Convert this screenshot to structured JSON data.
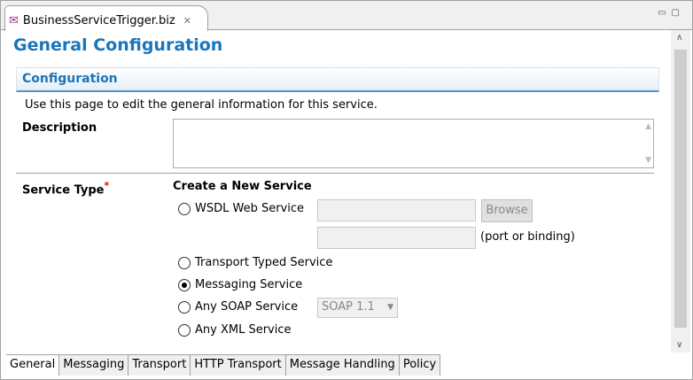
{
  "editor_tab": {
    "title": "BusinessServiceTrigger.biz",
    "icon": "biz-file-icon"
  },
  "page_title": "General Configuration",
  "section": {
    "title": "Configuration",
    "intro": "Use this page to edit the general information for this service."
  },
  "description": {
    "label": "Description",
    "value": ""
  },
  "service_type": {
    "label": "Service Type",
    "required_mark": "*",
    "heading": "Create a New Service",
    "options": [
      {
        "label": "WSDL Web Service",
        "selected": false
      },
      {
        "label": "Transport Typed Service",
        "selected": false
      },
      {
        "label": "Messaging Service",
        "selected": true
      },
      {
        "label": "Any SOAP Service",
        "selected": false
      },
      {
        "label": "Any XML Service",
        "selected": false
      }
    ],
    "browse_label": "Browse",
    "port_hint": "(port or binding)",
    "soap_version": "SOAP 1.1"
  },
  "bottom_tabs": [
    {
      "label": "General",
      "active": true
    },
    {
      "label": "Messaging"
    },
    {
      "label": "Transport"
    },
    {
      "label": "HTTP Transport"
    },
    {
      "label": "Message Handling"
    },
    {
      "label": "Policy"
    }
  ]
}
